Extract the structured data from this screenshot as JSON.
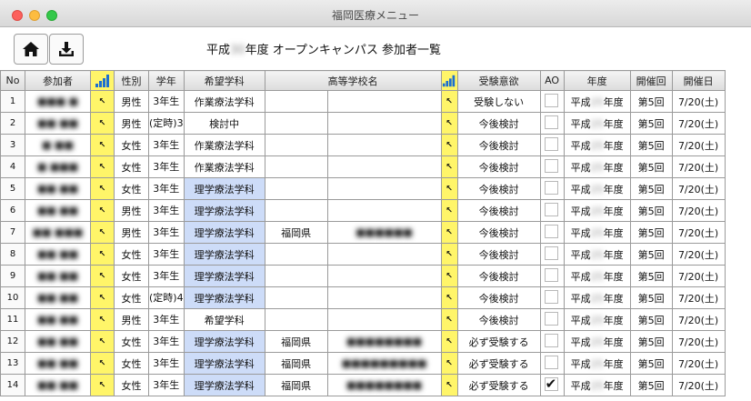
{
  "window": {
    "title": "福岡医療メニュー"
  },
  "toolbar": {
    "home_icon": "home-icon",
    "download_icon": "download-icon"
  },
  "page": {
    "title_prefix": "平成",
    "title_year": "30",
    "title_suffix": "年度 オープンキャンパス 参加者一覧"
  },
  "table": {
    "headers": {
      "no": "No",
      "name": "参加者",
      "gender": "性別",
      "grade": "学年",
      "dept": "希望学科",
      "school": "高等学校名",
      "intent": "受験意欲",
      "ao": "AO",
      "year": "年度",
      "session": "開催回",
      "date": "開催日"
    },
    "rows": [
      {
        "no": "1",
        "name": "■■■ ■",
        "gender": "男性",
        "grade": "3年生",
        "dept": "作業療法学科",
        "pref": "",
        "school": "",
        "intent": "受験しない",
        "ao": false,
        "year_prefix": "平成",
        "year_num": "25",
        "year_suffix": "年度",
        "session": "第5回",
        "date": "7/20(土)"
      },
      {
        "no": "2",
        "name": "■■ ■■",
        "gender": "男性",
        "grade": "(定時)3",
        "dept": "検討中",
        "pref": "",
        "school": "",
        "intent": "今後検討",
        "ao": false,
        "year_prefix": "平成",
        "year_num": "25",
        "year_suffix": "年度",
        "session": "第5回",
        "date": "7/20(土)"
      },
      {
        "no": "3",
        "name": "■ ■■",
        "gender": "女性",
        "grade": "3年生",
        "dept": "作業療法学科",
        "pref": "",
        "school": "",
        "intent": "今後検討",
        "ao": false,
        "year_prefix": "平成",
        "year_num": "25",
        "year_suffix": "年度",
        "session": "第5回",
        "date": "7/20(土)"
      },
      {
        "no": "4",
        "name": "■ ■■■",
        "gender": "女性",
        "grade": "3年生",
        "dept": "作業療法学科",
        "pref": "",
        "school": "",
        "intent": "今後検討",
        "ao": false,
        "year_prefix": "平成",
        "year_num": "25",
        "year_suffix": "年度",
        "session": "第5回",
        "date": "7/20(土)"
      },
      {
        "no": "5",
        "name": "■■ ■■",
        "gender": "女性",
        "grade": "3年生",
        "dept": "理学療法学科",
        "pref": "",
        "school": "",
        "intent": "今後検討",
        "ao": false,
        "year_prefix": "平成",
        "year_num": "25",
        "year_suffix": "年度",
        "session": "第5回",
        "date": "7/20(土)"
      },
      {
        "no": "6",
        "name": "■■ ■■",
        "gender": "男性",
        "grade": "3年生",
        "dept": "理学療法学科",
        "pref": "",
        "school": "",
        "intent": "今後検討",
        "ao": false,
        "year_prefix": "平成",
        "year_num": "25",
        "year_suffix": "年度",
        "session": "第5回",
        "date": "7/20(土)"
      },
      {
        "no": "7",
        "name": "■■ ■■■",
        "gender": "男性",
        "grade": "3年生",
        "dept": "理学療法学科",
        "pref": "福岡県",
        "school": "■■■■■■",
        "intent": "今後検討",
        "ao": false,
        "year_prefix": "平成",
        "year_num": "25",
        "year_suffix": "年度",
        "session": "第5回",
        "date": "7/20(土)"
      },
      {
        "no": "8",
        "name": "■■ ■■",
        "gender": "女性",
        "grade": "3年生",
        "dept": "理学療法学科",
        "pref": "",
        "school": "",
        "intent": "今後検討",
        "ao": false,
        "year_prefix": "平成",
        "year_num": "25",
        "year_suffix": "年度",
        "session": "第5回",
        "date": "7/20(土)"
      },
      {
        "no": "9",
        "name": "■■ ■■",
        "gender": "女性",
        "grade": "3年生",
        "dept": "理学療法学科",
        "pref": "",
        "school": "",
        "intent": "今後検討",
        "ao": false,
        "year_prefix": "平成",
        "year_num": "25",
        "year_suffix": "年度",
        "session": "第5回",
        "date": "7/20(土)"
      },
      {
        "no": "10",
        "name": "■■ ■■",
        "gender": "女性",
        "grade": "(定時)4",
        "dept": "理学療法学科",
        "pref": "",
        "school": "",
        "intent": "今後検討",
        "ao": false,
        "year_prefix": "平成",
        "year_num": "25",
        "year_suffix": "年度",
        "session": "第5回",
        "date": "7/20(土)"
      },
      {
        "no": "11",
        "name": "■■ ■■",
        "gender": "男性",
        "grade": "3年生",
        "dept": "希望学科",
        "pref": "",
        "school": "",
        "intent": "今後検討",
        "ao": false,
        "year_prefix": "平成",
        "year_num": "25",
        "year_suffix": "年度",
        "session": "第5回",
        "date": "7/20(土)"
      },
      {
        "no": "12",
        "name": "■■ ■■",
        "gender": "女性",
        "grade": "3年生",
        "dept": "理学療法学科",
        "pref": "福岡県",
        "school": "■■■■■■■■",
        "intent": "必ず受験する",
        "ao": false,
        "year_prefix": "平成",
        "year_num": "25",
        "year_suffix": "年度",
        "session": "第5回",
        "date": "7/20(土)"
      },
      {
        "no": "13",
        "name": "■■ ■■",
        "gender": "女性",
        "grade": "3年生",
        "dept": "理学療法学科",
        "pref": "福岡県",
        "school": "■■■■■■■■■",
        "intent": "必ず受験する",
        "ao": false,
        "year_prefix": "平成",
        "year_num": "25",
        "year_suffix": "年度",
        "session": "第5回",
        "date": "7/20(土)"
      },
      {
        "no": "14",
        "name": "■■ ■■",
        "gender": "女性",
        "grade": "3年生",
        "dept": "理学療法学科",
        "pref": "福岡県",
        "school": "■■■■■■■■",
        "intent": "必ず受験する",
        "ao": true,
        "year_prefix": "平成",
        "year_num": "25",
        "year_suffix": "年度",
        "session": "第5回",
        "date": "7/20(土)"
      }
    ]
  },
  "colors": {
    "sort_yellow": "#fff569",
    "dept_blue": "#cddcf8",
    "sort_bar_blue": "#1c6fd1"
  }
}
